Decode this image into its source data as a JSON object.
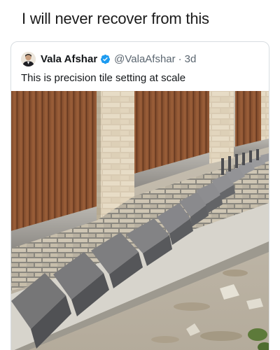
{
  "caption": "I will never recover from this",
  "tweet": {
    "display_name": "Vala Afshar",
    "handle": "@ValaAfshar",
    "separator": "·",
    "timestamp": "3d",
    "text": "This is precision tile setting at scale"
  },
  "icons": {
    "verified": "verified-badge-icon",
    "avatar": "profile-avatar"
  },
  "colors": {
    "verified_blue": "#1d9bf0",
    "name_text": "#14171a",
    "secondary_text": "#5b6670"
  }
}
